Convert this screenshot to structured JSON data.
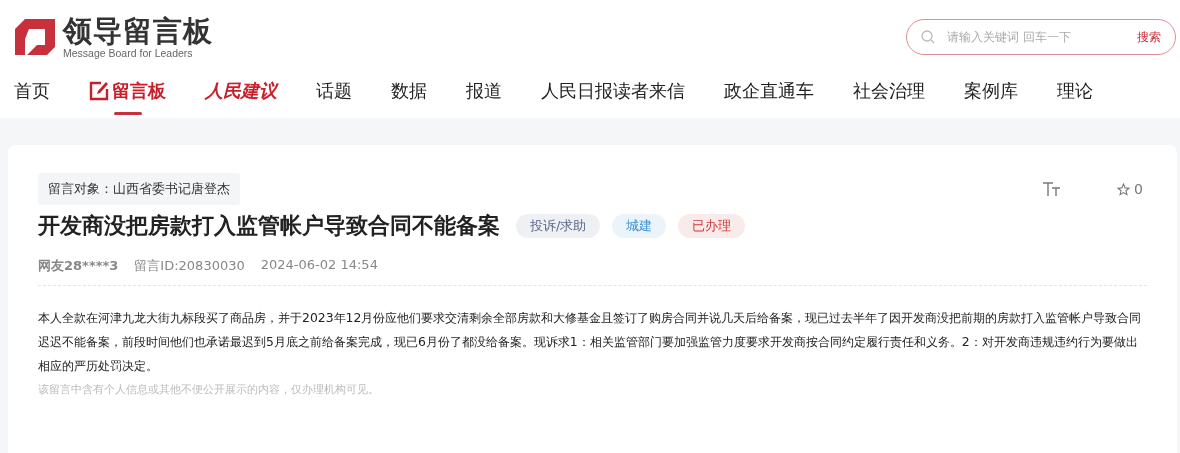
{
  "logo": {
    "title": "领导留言板",
    "subtitle": "Message Board for Leaders"
  },
  "search": {
    "placeholder": "请输入关键词 回车一下",
    "button": "搜索"
  },
  "nav": [
    {
      "label": "首页",
      "kind": "plain",
      "selected": false
    },
    {
      "label": "留言板",
      "kind": "icon",
      "selected": true
    },
    {
      "label": "人民建议",
      "kind": "logo",
      "selected": false
    },
    {
      "label": "话题",
      "kind": "plain",
      "selected": false
    },
    {
      "label": "数据",
      "kind": "plain",
      "selected": false
    },
    {
      "label": "报道",
      "kind": "plain",
      "selected": false
    },
    {
      "label": "人民日报读者来信",
      "kind": "plain",
      "selected": false
    },
    {
      "label": "政企直通车",
      "kind": "plain",
      "selected": false
    },
    {
      "label": "社会治理",
      "kind": "plain",
      "selected": false
    },
    {
      "label": "案例库",
      "kind": "plain",
      "selected": false
    },
    {
      "label": "理论",
      "kind": "plain",
      "selected": false
    }
  ],
  "message": {
    "target": "留言对象：山西省委书记唐登杰",
    "favorites": "0",
    "title": "开发商没把房款打入监管帐户导致合同不能备案",
    "tags": [
      {
        "label": "投诉/求助",
        "color": "#5b6a8a"
      },
      {
        "label": "城建",
        "color": "#3a8fd0"
      },
      {
        "label": "已办理",
        "color": "#d0383f"
      }
    ],
    "author": "网友28****3",
    "id": "留言ID:20830030",
    "time": "2024-06-02 14:54",
    "body": "本人全款在河津九龙大街九标段买了商品房，并于2023年12月份应他们要求交清剩余全部房款和大修基金且签订了购房合同并说几天后给备案，现已过去半年了因开发商没把前期的房款打入监管帐户导致合同迟迟不能备案，前段时间他们也承诺最迟到5月底之前给备案完成，现已6月份了都没给备案。现诉求1：相关监管部门要加强监管力度要求开发商按合同约定履行责任和义务。2：对开发商违规违约行为要做出相应的严历处罚决定。",
    "note": "该留言中含有个人信息或其他不便公开展示的内容，仅办理机构可见。"
  }
}
